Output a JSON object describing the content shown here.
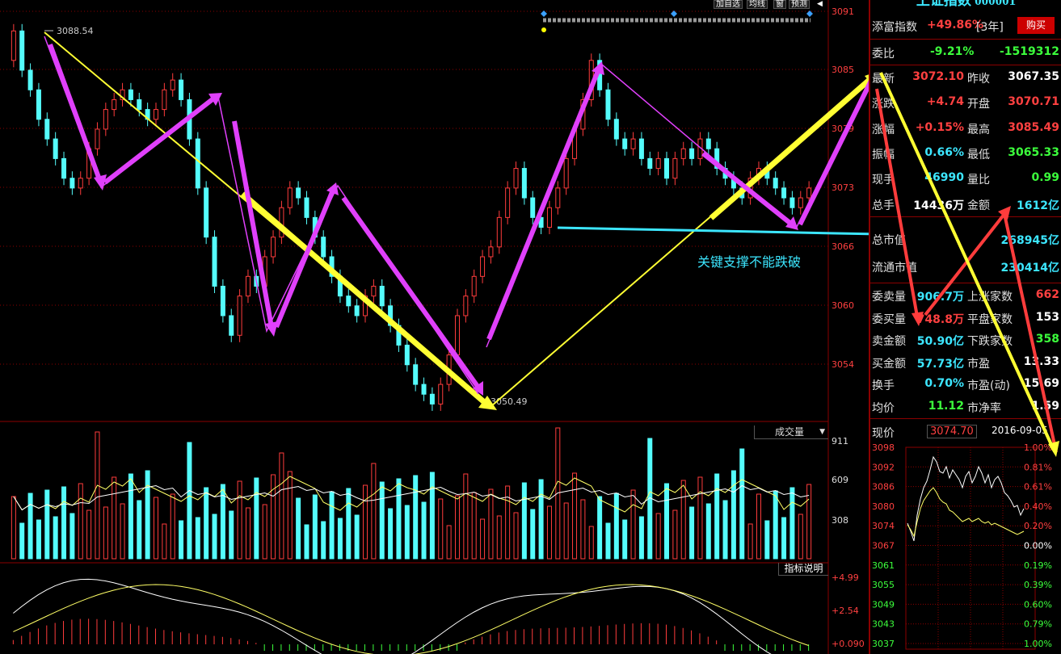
{
  "toolbar": {
    "items": [
      "加自选",
      "均线",
      "窗",
      "预测"
    ]
  },
  "panel": {
    "title": "上证指数 000001",
    "fortune_label": "添富指数",
    "fortune_value": "+49.86%",
    "fortune_period": "[3年]",
    "buy_button": "购买",
    "weibi_label": "委比",
    "weibi_pct": "-9.21%",
    "weibi_val": "-1519312",
    "rows": [
      {
        "l1": "最新",
        "v1": "3072.10",
        "c1": "red",
        "l2": "昨收",
        "v2": "3067.35",
        "c2": "white"
      },
      {
        "l1": "涨跌",
        "v1": "+4.74",
        "c1": "red",
        "l2": "开盘",
        "v2": "3070.71",
        "c2": "red"
      },
      {
        "l1": "涨幅",
        "v1": "+0.15%",
        "c1": "red",
        "l2": "最高",
        "v2": "3085.49",
        "c2": "red"
      },
      {
        "l1": "振幅",
        "v1": "0.66%",
        "c1": "cyan",
        "l2": "最低",
        "v2": "3065.33",
        "c2": "green"
      },
      {
        "l1": "现手",
        "v1": "46990",
        "c1": "cyan",
        "l2": "量比",
        "v2": "0.99",
        "c2": "green"
      },
      {
        "l1": "总手",
        "v1": "14436万",
        "c1": "white",
        "l2": "金额",
        "v2": "1612亿",
        "c2": "cyan"
      }
    ],
    "mktcap_label": "总市值",
    "mktcap_value": "268945亿",
    "float_label": "流通市值",
    "float_value": "230414亿",
    "rows2": [
      {
        "l1": "委卖量",
        "v1": "906.7万",
        "c1": "cyan",
        "l2": "上涨家数",
        "v2": "662",
        "c2": "red"
      },
      {
        "l1": "委买量",
        "v1": "748.8万",
        "c1": "red",
        "l2": "平盘家数",
        "v2": "153",
        "c2": "white"
      },
      {
        "l1": "卖金额",
        "v1": "50.90亿",
        "c1": "cyan",
        "l2": "下跌家数",
        "v2": "358",
        "c2": "green"
      },
      {
        "l1": "买金额",
        "v1": "57.73亿",
        "c1": "cyan",
        "l2": "市盈",
        "v2": "13.33",
        "c2": "white"
      },
      {
        "l1": "换手",
        "v1": "0.70%",
        "c1": "cyan",
        "l2": "市盈(动)",
        "v2": "15.69",
        "c2": "white"
      },
      {
        "l1": "均价",
        "v1": "11.12",
        "c1": "green",
        "l2": "市净率",
        "v2": "1.59",
        "c2": "white"
      }
    ],
    "now_label": "现价",
    "now_value": "3074.70",
    "date": "2016-09-05"
  },
  "main_chart": {
    "price_axis": [
      "3091",
      "3085",
      "3079",
      "3073",
      "3066",
      "3060",
      "3054"
    ],
    "high_label": "3088.54",
    "low_label": "3050.49",
    "annotation": "关键支撑不能跌破"
  },
  "volume_chart": {
    "title": "成交量",
    "axis": [
      "911",
      "609",
      "308"
    ]
  },
  "indicator_chart": {
    "title": "指标说明",
    "axis": [
      "+4.99",
      "+2.54",
      "+0.090"
    ]
  },
  "mini_chart": {
    "left_axis": [
      "3098",
      "3092",
      "3086",
      "3080",
      "3074",
      "3067",
      "3061",
      "3055",
      "3049",
      "3043",
      "3037"
    ],
    "right_axis": [
      "1.00%",
      "0.81%",
      "0.61%",
      "0.40%",
      "0.20%",
      "0.00%",
      "0.19%",
      "0.39%",
      "0.60%",
      "0.79%",
      "1.00%"
    ]
  },
  "colors": {
    "up": "#ff3c3c",
    "down": "#54fcfc",
    "magenta": "#e040fb",
    "yellow": "#ffff33",
    "grid": "#8b0000"
  }
}
